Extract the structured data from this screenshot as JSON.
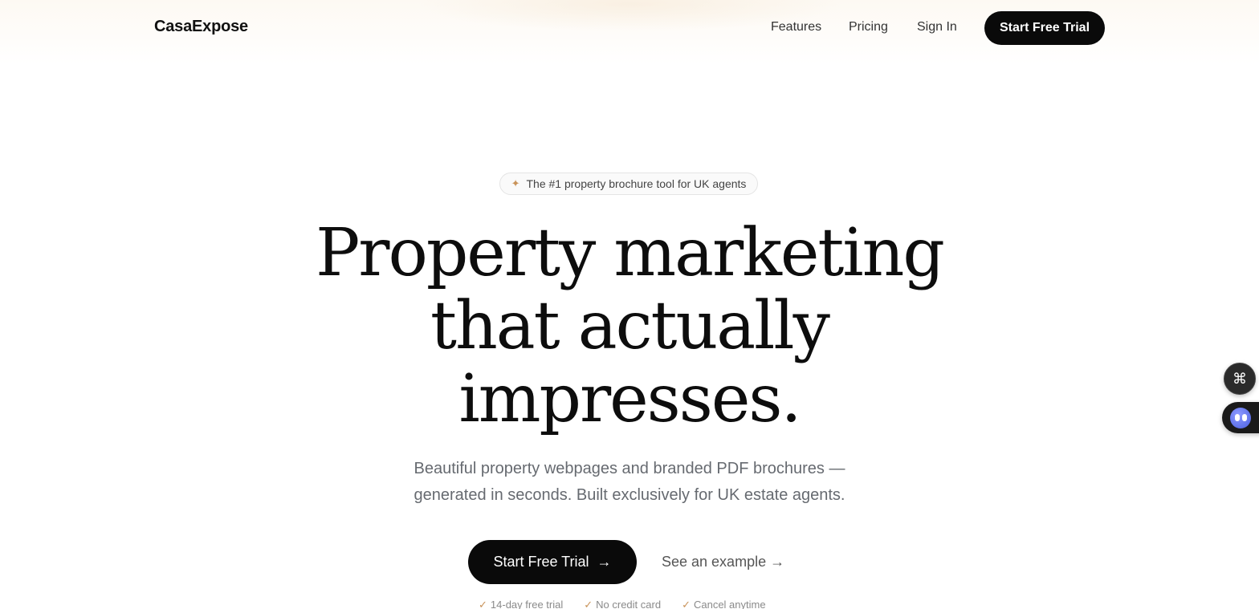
{
  "nav": {
    "logo": "CasaExpose",
    "links": [
      "Features",
      "Pricing",
      "Sign In"
    ],
    "cta_label": "Start Free Trial"
  },
  "hero": {
    "badge_icon": "sparkle-icon",
    "badge_text": "The #1 property brochure tool for UK agents",
    "headline_lines": [
      "Property marketing",
      "that actually",
      "impresses."
    ],
    "subtitle_lines": [
      "Beautiful property webpages and branded PDF brochures —",
      "generated in seconds. Built exclusively for UK estate agents."
    ],
    "primary_cta": "Start Free Trial",
    "primary_cta_icon": "arrow-right-icon",
    "secondary_cta": "See an example →",
    "checks": [
      "14-day free trial",
      "No credit card",
      "Cancel anytime"
    ]
  },
  "widgets": {
    "command_icon": "command-icon",
    "assistant_icon": "assistant-bot-icon"
  },
  "colors": {
    "accent": "#c9935a",
    "primary_button": "#0a0a0a",
    "subtitle_text": "#666a70"
  }
}
